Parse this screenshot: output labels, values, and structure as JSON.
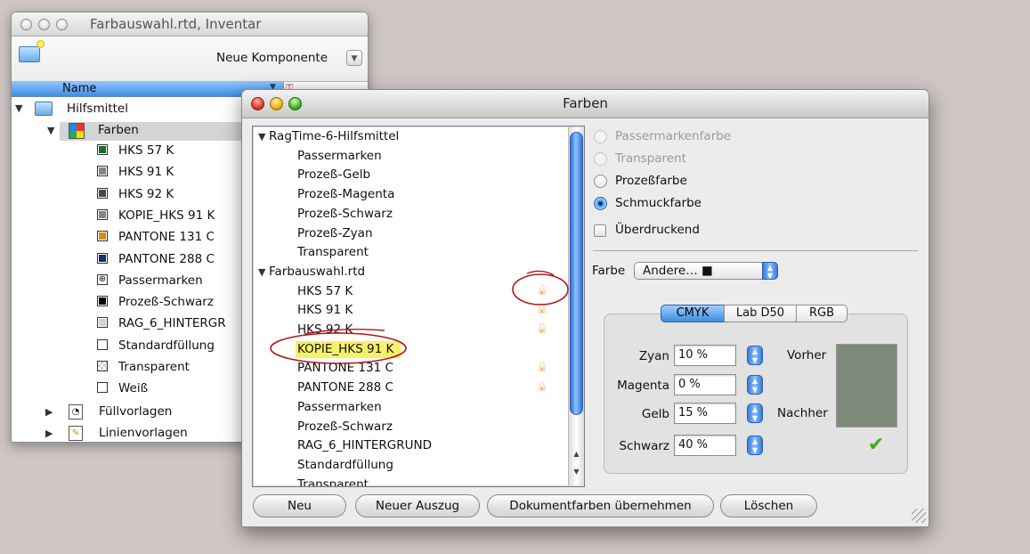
{
  "inventory_window": {
    "title": "Farbauswahl.rtd, Inventar",
    "new_component_label": "Neue Komponente",
    "column_name": "Name",
    "root_label": "Hilfsmittel",
    "farben_label": "Farben",
    "items": [
      {
        "label": "HKS 57 K",
        "color": "#1b6a2c",
        "icon": "swatch"
      },
      {
        "label": "HKS 91 K",
        "color": "#7e8a7a",
        "icon": "swatch"
      },
      {
        "label": "HKS 92 K",
        "color": "#404c44",
        "icon": "swatch"
      },
      {
        "label": "KOPIE_HKS 91 K",
        "color": "#7e8a7a",
        "icon": "swatch"
      },
      {
        "label": "PANTONE 131 C",
        "color": "#d08f19",
        "icon": "swatch"
      },
      {
        "label": "PANTONE 288 C",
        "color": "#12326b",
        "icon": "swatch"
      },
      {
        "label": "Passermarken",
        "color": "#ffffff",
        "icon": "registration"
      },
      {
        "label": "Prozeß-Schwarz",
        "color": "#000000",
        "icon": "swatch"
      },
      {
        "label": "RAG_6_HINTERGR",
        "color": "#d7d0d0",
        "icon": "swatch"
      },
      {
        "label": "Standardfüllung",
        "color": "#ffffff",
        "icon": "swatch"
      },
      {
        "label": "Transparent",
        "color": "#ffffff",
        "icon": "transparent"
      },
      {
        "label": "Weiß",
        "color": "#ffffff",
        "icon": "swatch"
      }
    ],
    "fill_templates_label": "Füllvorlagen",
    "line_templates_label": "Linienvorlagen"
  },
  "farben_window": {
    "title": "Farben",
    "list": {
      "group1_label": "RagTime-6-Hilfsmittel",
      "group1_items": [
        "Passermarken",
        "Prozeß-Gelb",
        "Prozeß-Magenta",
        "Prozeß-Schwarz",
        "Prozeß-Zyan",
        "Transparent"
      ],
      "group2_label": "Farbauswahl.rtd",
      "group2_items": [
        {
          "label": "HKS 57 K",
          "locked": true
        },
        {
          "label": "HKS 91 K",
          "locked": true
        },
        {
          "label": "HKS 92 K",
          "locked": true
        },
        {
          "label": "KOPIE_HKS 91 K",
          "locked": false,
          "selected": true
        },
        {
          "label": "PANTONE 131 C",
          "locked": true
        },
        {
          "label": "PANTONE 288 C",
          "locked": true
        },
        {
          "label": "Passermarken",
          "locked": false
        },
        {
          "label": "Prozeß-Schwarz",
          "locked": false
        },
        {
          "label": "RAG_6_HINTERGRUND",
          "locked": false
        },
        {
          "label": "Standardfüllung",
          "locked": false
        },
        {
          "label": "Transparent",
          "locked": false
        }
      ]
    },
    "options": {
      "passer": "Passermarkenfarbe",
      "transparent": "Transparent",
      "process": "Prozeßfarbe",
      "spot": "Schmuckfarbe",
      "selected": "Schmuckfarbe",
      "overprint": "Überdruckend",
      "overprint_checked": false
    },
    "farbe_label": "Farbe",
    "farbe_value": "Andere… ■",
    "model_tabs": [
      "CMYK",
      "Lab D50",
      "RGB"
    ],
    "model_selected": "CMYK",
    "fields": [
      {
        "label": "Zyan",
        "value": "10 %"
      },
      {
        "label": "Magenta",
        "value": "0 %"
      },
      {
        "label": "Gelb",
        "value": "15 %"
      },
      {
        "label": "Schwarz",
        "value": "40 %"
      }
    ],
    "before_label": "Vorher",
    "after_label": "Nachher",
    "preview_color": "#7e8a7a",
    "buttons": {
      "new": "Neu",
      "new_separation": "Neuer Auszug",
      "adopt": "Dokumentfarben übernehmen",
      "delete": "Löschen"
    }
  }
}
